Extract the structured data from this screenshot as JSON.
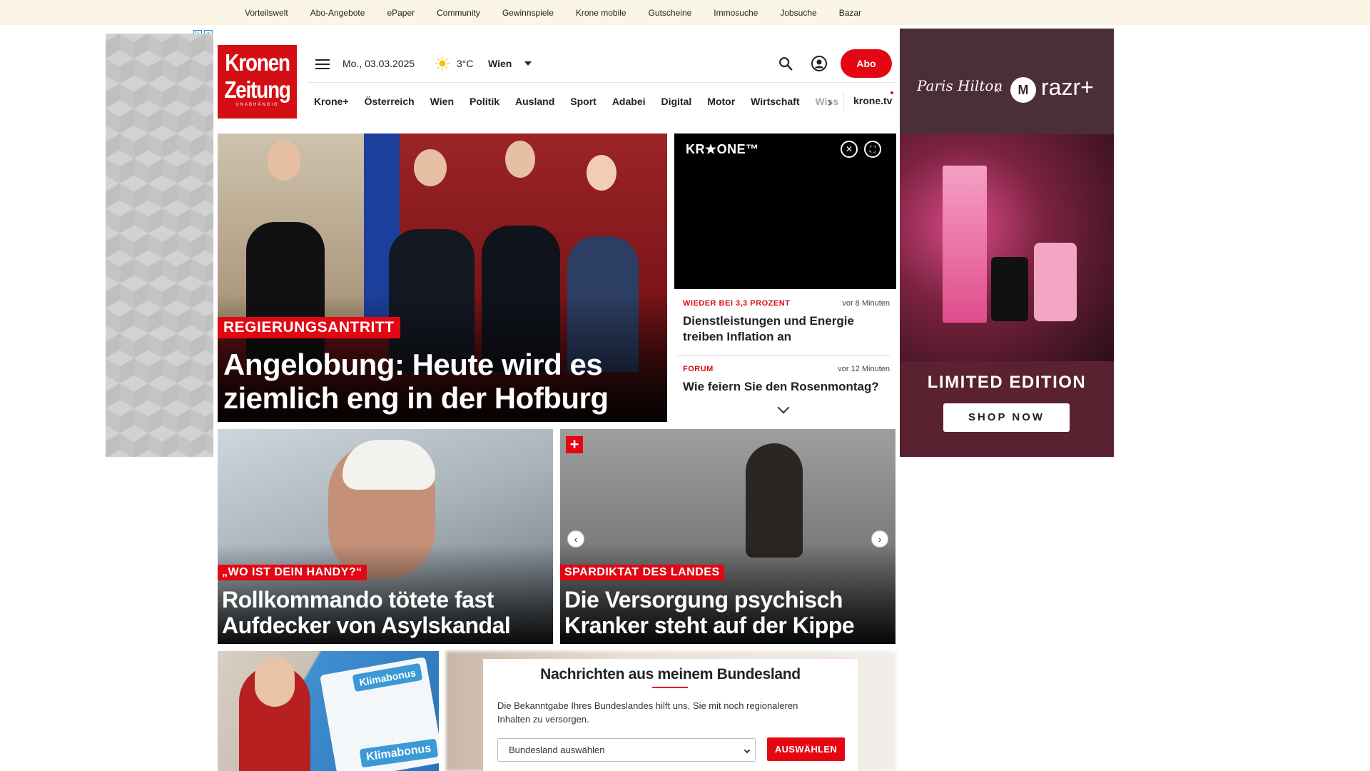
{
  "topbar": {
    "links": [
      "Vorteilswelt",
      "Abo-Angebote",
      "ePaper",
      "Community",
      "Gewinnspiele",
      "Krone mobile",
      "Gutscheine",
      "Immosuche",
      "Jobsuche",
      "Bazar"
    ]
  },
  "logo": {
    "line1": "Kronen",
    "line2": "Zeitung",
    "line3": "UNABHÄNGIG"
  },
  "header": {
    "date": "Mo., 03.03.2025",
    "temperature": "3°C",
    "city": "Wien",
    "abo_label": "Abo"
  },
  "nav": {
    "items": [
      "Krone+",
      "Österreich",
      "Wien",
      "Politik",
      "Ausland",
      "Sport",
      "Adabei",
      "Digital",
      "Motor",
      "Wirtschaft"
    ],
    "faded_item": "Wiss",
    "kronetv": "krone.tv"
  },
  "hero": {
    "kicker": "REGIERUNGSANTRITT",
    "title": "Angelobung: Heute wird es ziemlich eng in der Hofburg"
  },
  "video": {
    "brand": "KR★ONE™"
  },
  "ticker": [
    {
      "kicker": "WIEDER BEI 3,3 PROZENT",
      "time": "vor 8 Minuten",
      "headline": "Dienstleistungen und Energie treiben Inflation an"
    },
    {
      "kicker": "FORUM",
      "time": "vor 12 Minuten",
      "headline": "Wie feiern Sie den Rosenmontag?"
    }
  ],
  "cards": [
    {
      "kicker": "„WO IST DEIN HANDY?“",
      "title": "Rollkommando tötete fast Aufdecker von Asylskandal"
    },
    {
      "kicker": "SPARDIKTAT DES LANDES",
      "title": "Die Versorgung psychisch Kranker steht auf der Kippe"
    }
  ],
  "ad_right": {
    "signature": "Paris Hilton",
    "x": "×",
    "brand": "razr+",
    "headline": "LIMITED EDITION",
    "cta": "SHOP NOW"
  },
  "bottom_image": {
    "label1": "Klimabonus",
    "label2": "Klimabonus"
  },
  "bundesland": {
    "title": "Nachrichten aus meinem Bundesland",
    "text": "Die Bekanntgabe Ihres Bundeslandes hilft uns, Sie mit noch regionaleren Inhalten zu versorgen.",
    "select_value": "Bundesland auswählen",
    "button": "AUSWÄHLEN"
  },
  "colors": {
    "accent": "#e30613",
    "topbar": "#faf5e4"
  }
}
